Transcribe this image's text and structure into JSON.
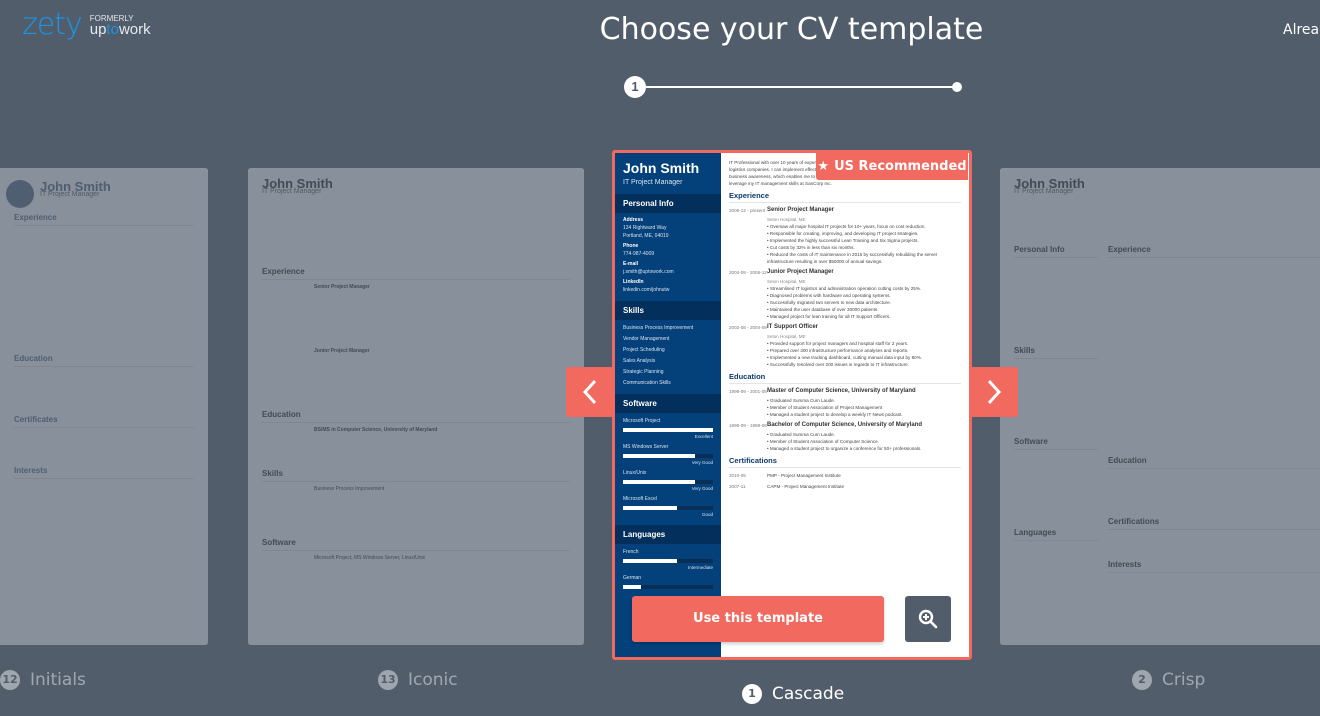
{
  "header": {
    "logo": "zety",
    "logo_formerly": "FORMERLY",
    "logo_sub_1": "up",
    "logo_sub_2": "to",
    "logo_sub_3": "work",
    "title": "Choose your CV template",
    "already_link": "Already have an account?",
    "steps": {
      "current": "1",
      "total_steps": 2
    }
  },
  "carousel": {
    "prev_label": "previous",
    "next_label": "next",
    "templates": [
      {
        "number": "12",
        "name": "Initials"
      },
      {
        "number": "13",
        "name": "Iconic"
      },
      {
        "number": "1",
        "name": "Cascade"
      },
      {
        "number": "2",
        "name": "Crisp"
      }
    ],
    "badge": "US Recommended",
    "use_button": "Use this template",
    "zoom_button": "zoom-in"
  },
  "resume": {
    "name": "John Smith",
    "job_title": "IT Project Manager",
    "summary": "IT Professional with over 10 years of experience specializing in IT department management for international logistics companies. I can implement effective IT strategies at local and global levels. My greatest strength is business awareness, which enables me to permanently streamline infrastructure and applications. Striving to leverage my IT management skills at SanCorp Inc.",
    "personal_info_title": "Personal Info",
    "personal": [
      {
        "key": "Address",
        "value": "134 Rightward Way\nPortland, ME, 04019"
      },
      {
        "key": "Phone",
        "value": "774-987-4009"
      },
      {
        "key": "E-mail",
        "value": "j.smith@uptowork.com"
      },
      {
        "key": "LinkedIn",
        "value": "linkedin.com/johnutw"
      }
    ],
    "skills_title": "Skills",
    "skills": [
      "Business Process Improvement",
      "Vendor Management",
      "Project Scheduling",
      "Sales Analysis",
      "Strategic Planning",
      "Communication Skills"
    ],
    "software_title": "Software",
    "software": [
      {
        "name": "Microsoft Project",
        "level": "Excellent",
        "value": 1.0
      },
      {
        "name": "MS Windows Server",
        "level": "Very Good",
        "value": 0.8
      },
      {
        "name": "Linux/Unix",
        "level": "Very Good",
        "value": 0.8
      },
      {
        "name": "Microsoft Excel",
        "level": "Good",
        "value": 0.6
      }
    ],
    "languages_title": "Languages",
    "languages": [
      {
        "name": "French",
        "level": "Intermediate",
        "value": 0.6
      },
      {
        "name": "German",
        "level": "",
        "value": 0.2
      }
    ],
    "experience_title": "Experience",
    "experience": [
      {
        "date": "2006-12 - present",
        "title": "Senior Project Manager",
        "company": "Seton Hospital, ME",
        "bullets": [
          "Oversaw all major hospital IT projects for 10+ years, focus on cost reduction.",
          "Responsible for creating, improving, and developing IT project strategies.",
          "Implemented the highly successful Lean Training and Six Sigma projects.",
          "Cut costs by 32% in less than six months.",
          "Reduced the costs of IT maintenance in 2015 by successfully rebuilding the server infrastructure resulting in over $50000 of annual savings."
        ]
      },
      {
        "date": "2004-09 - 2006-12",
        "title": "Junior Project Manager",
        "company": "Seton Hospital, ME",
        "bullets": [
          "Streamlined IT logistics and administration operation cutting costs by 25%.",
          "Diagnosed problems with hardware and operating systems.",
          "Successfully migrated two servers to new data architecture.",
          "Maintained the user database of over 30000 patients.",
          "Managed project for lean training for all IT Support Officers."
        ]
      },
      {
        "date": "2002-08 - 2004-09",
        "title": "IT Support Officer",
        "company": "Seton Hospital, ME",
        "bullets": [
          "Provided support for project managers and hospital staff for 2 years.",
          "Prepared over 300 infrastructure performance analyses and reports.",
          "Implemented a new tracking dashboard, cutting manual data input by 80%.",
          "Successfully resolved over 200 issues in regards to IT infrastructure."
        ]
      }
    ],
    "education_title": "Education",
    "education": [
      {
        "date": "1999-09 - 2001-05",
        "title": "Master of Computer Science, University of Maryland",
        "bullets": [
          "Graduated Summa Cum Laude.",
          "Member of Student Association of Project Management",
          "Managed a student project to develop a weekly IT News podcast."
        ]
      },
      {
        "date": "1996-09 - 1999-06",
        "title": "Bachelor of Computer Science, University of Maryland",
        "bullets": [
          "Graduated Summa Cum Laude.",
          "Member of Student Association of Computer Science.",
          "Managed a student project to organize a conference for 50+ professionals."
        ]
      }
    ],
    "certifications_title": "Certifications",
    "certifications": [
      {
        "date": "2010-05",
        "title": "PMP - Project Management Institute"
      },
      {
        "date": "2007-11",
        "title": "CAPM - Project Management Institute"
      }
    ]
  },
  "side_cards": {
    "iconic": {
      "name": "John Smith",
      "job_title": "IT Project Manager",
      "sections": [
        "Experience",
        "Education",
        "Skills",
        "Software"
      ],
      "lines": [
        "Senior Project Manager",
        "Junior Project Manager",
        "BS/MS in Computer Science, University of Maryland",
        "Business Process Improvement",
        "Microsoft Project, MS Windows Server, Linux/Unix"
      ]
    },
    "crisp": {
      "name": "John Smith",
      "job_title": "IT Project Manager",
      "sections": [
        "Personal Info",
        "Experience",
        "Skills",
        "Software",
        "Education",
        "Languages",
        "Certifications",
        "Interests"
      ]
    },
    "initials": {
      "name": "John Smith",
      "job_title": "IT Project Manager",
      "sections": [
        "Experience",
        "Education",
        "Certificates",
        "Interests"
      ]
    }
  }
}
